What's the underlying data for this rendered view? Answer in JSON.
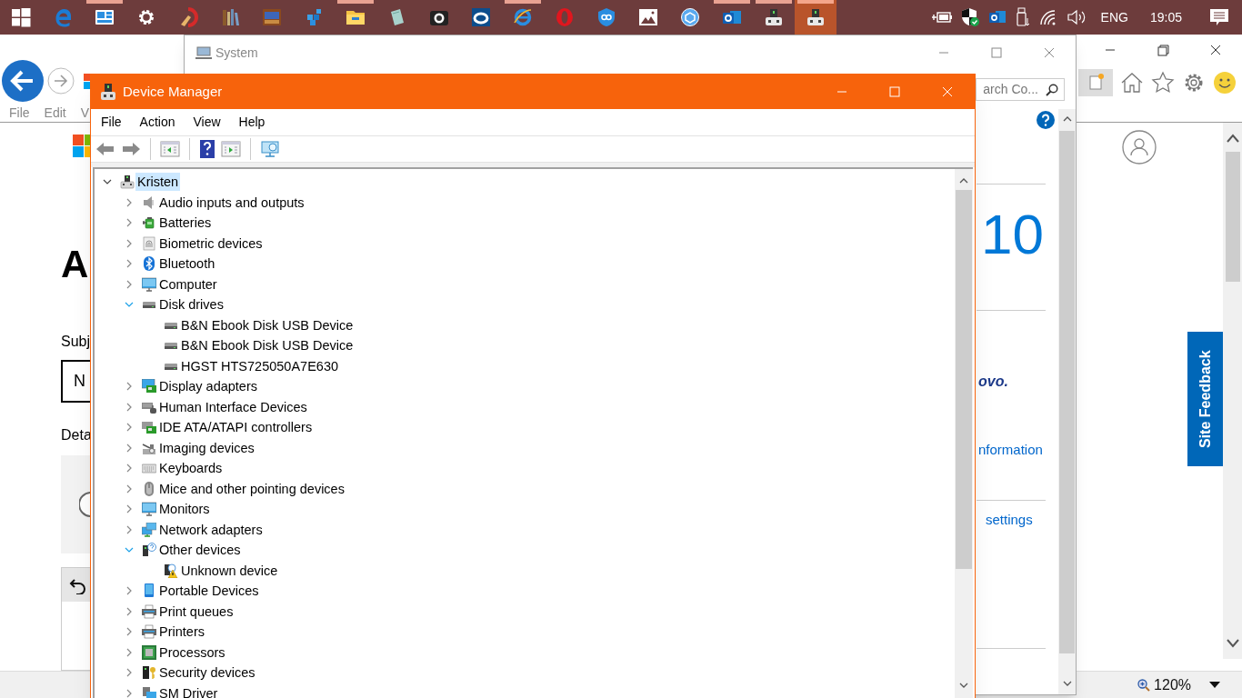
{
  "taskbar": {
    "apps": [
      {
        "kind": "start",
        "running": false,
        "selected": false
      },
      {
        "kind": "edge",
        "running": false,
        "selected": false
      },
      {
        "kind": "panel",
        "running": true,
        "selected": false
      },
      {
        "kind": "gear",
        "running": false,
        "selected": false
      },
      {
        "kind": "brush",
        "running": false,
        "selected": false
      },
      {
        "kind": "books",
        "running": false,
        "selected": false
      },
      {
        "kind": "cards",
        "running": false,
        "selected": false
      },
      {
        "kind": "cubes",
        "running": false,
        "selected": false
      },
      {
        "kind": "folder",
        "running": true,
        "selected": false
      },
      {
        "kind": "notepad",
        "running": false,
        "selected": false
      },
      {
        "kind": "camera",
        "running": false,
        "selected": false
      },
      {
        "kind": "ring",
        "running": false,
        "selected": false
      },
      {
        "kind": "ie",
        "running": true,
        "selected": false
      },
      {
        "kind": "opera",
        "running": false,
        "selected": false
      },
      {
        "kind": "shield",
        "running": false,
        "selected": false
      },
      {
        "kind": "photos",
        "running": false,
        "selected": false
      },
      {
        "kind": "globe",
        "running": false,
        "selected": false
      },
      {
        "kind": "mail",
        "running": true,
        "selected": false
      },
      {
        "kind": "device",
        "running": true,
        "selected": false
      },
      {
        "kind": "device",
        "running": true,
        "selected": true
      }
    ],
    "language": "ENG",
    "time": "19:05"
  },
  "browser": {
    "menu": [
      "File",
      "Edit",
      "V"
    ],
    "heading": "A",
    "subject_label": "Subj",
    "subject_value": "N",
    "details_label": "Deta",
    "zoom": "120%",
    "feedback": "Site Feedback"
  },
  "system_window": {
    "title": "System",
    "search_placeholder": "arch Co...",
    "edition": "10",
    "logo": "ovo.",
    "links": [
      "nformation",
      "settings"
    ]
  },
  "device_manager": {
    "title": "Device Manager",
    "menu": [
      "File",
      "Action",
      "View",
      "Help"
    ],
    "tree": {
      "label": "Kristen",
      "kind": "computer",
      "expanded": true,
      "selected": true,
      "children": [
        {
          "label": "Audio inputs and outputs",
          "kind": "speaker",
          "expanded": false,
          "selected": false
        },
        {
          "label": "Batteries",
          "kind": "battery",
          "expanded": false,
          "selected": false
        },
        {
          "label": "Biometric devices",
          "kind": "fingerprint",
          "expanded": false,
          "selected": false
        },
        {
          "label": "Bluetooth",
          "kind": "bluetooth",
          "expanded": false,
          "selected": false
        },
        {
          "label": "Computer",
          "kind": "monitor",
          "expanded": false,
          "selected": false
        },
        {
          "label": "Disk drives",
          "kind": "drive",
          "expanded": true,
          "selected": false,
          "children": [
            {
              "label": "B&N Ebook Disk USB Device",
              "kind": "drive",
              "selected": false
            },
            {
              "label": "B&N Ebook Disk USB Device",
              "kind": "drive",
              "selected": false
            },
            {
              "label": "HGST HTS725050A7E630",
              "kind": "drive",
              "selected": false
            }
          ]
        },
        {
          "label": "Display adapters",
          "kind": "display",
          "expanded": false,
          "selected": false
        },
        {
          "label": "Human Interface Devices",
          "kind": "hid",
          "expanded": false,
          "selected": false
        },
        {
          "label": "IDE ATA/ATAPI controllers",
          "kind": "card",
          "expanded": false,
          "selected": false
        },
        {
          "label": "Imaging devices",
          "kind": "imaging",
          "expanded": false,
          "selected": false
        },
        {
          "label": "Keyboards",
          "kind": "keyboard",
          "expanded": false,
          "selected": false
        },
        {
          "label": "Mice and other pointing devices",
          "kind": "mouse",
          "expanded": false,
          "selected": false
        },
        {
          "label": "Monitors",
          "kind": "monitor",
          "expanded": false,
          "selected": false
        },
        {
          "label": "Network adapters",
          "kind": "network",
          "expanded": false,
          "selected": false
        },
        {
          "label": "Other devices",
          "kind": "other",
          "expanded": true,
          "selected": false,
          "children": [
            {
              "label": "Unknown device",
              "kind": "warning",
              "selected": false
            }
          ]
        },
        {
          "label": "Portable Devices",
          "kind": "portable",
          "expanded": false,
          "selected": false
        },
        {
          "label": "Print queues",
          "kind": "printer",
          "expanded": false,
          "selected": false
        },
        {
          "label": "Printers",
          "kind": "printer",
          "expanded": false,
          "selected": false
        },
        {
          "label": "Processors",
          "kind": "chip",
          "expanded": false,
          "selected": false
        },
        {
          "label": "Security devices",
          "kind": "security",
          "expanded": false,
          "selected": false
        },
        {
          "label": "SM Driver",
          "kind": "sm",
          "expanded": false,
          "selected": false
        }
      ]
    }
  }
}
